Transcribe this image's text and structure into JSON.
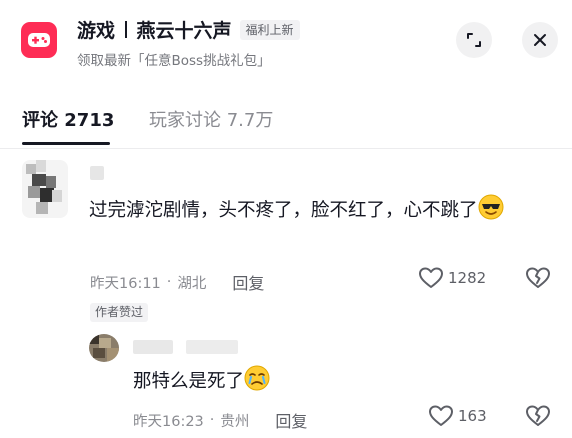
{
  "header": {
    "title": "游戏",
    "game_name": "燕云十六声",
    "badge": "福利上新",
    "subtitle": "领取最新「任意Boss挑战礼包」",
    "app_icon": "gamepad-icon",
    "expand_icon": "minimize-icon",
    "close_icon": "close-icon",
    "accent_color": "#fe2c55"
  },
  "tabs": [
    {
      "label": "评论 2713",
      "active": true
    },
    {
      "label": "玩家讨论 7.7万",
      "active": false
    }
  ],
  "comments": [
    {
      "text": "过完滹沱剧情，头不疼了，脸不红了，心不跳了",
      "emoji": "cool-sunglasses-emoji",
      "time": "昨天16:11",
      "location": "湖北",
      "reply_label": "回复",
      "likes": "1282",
      "tag": "作者赞过"
    }
  ],
  "replies": [
    {
      "text": "那特么是死了",
      "emoji": "crying-emoji",
      "time": "昨天16:23",
      "location": "贵州",
      "reply_label": "回复",
      "likes": "163"
    }
  ],
  "separator": "·"
}
